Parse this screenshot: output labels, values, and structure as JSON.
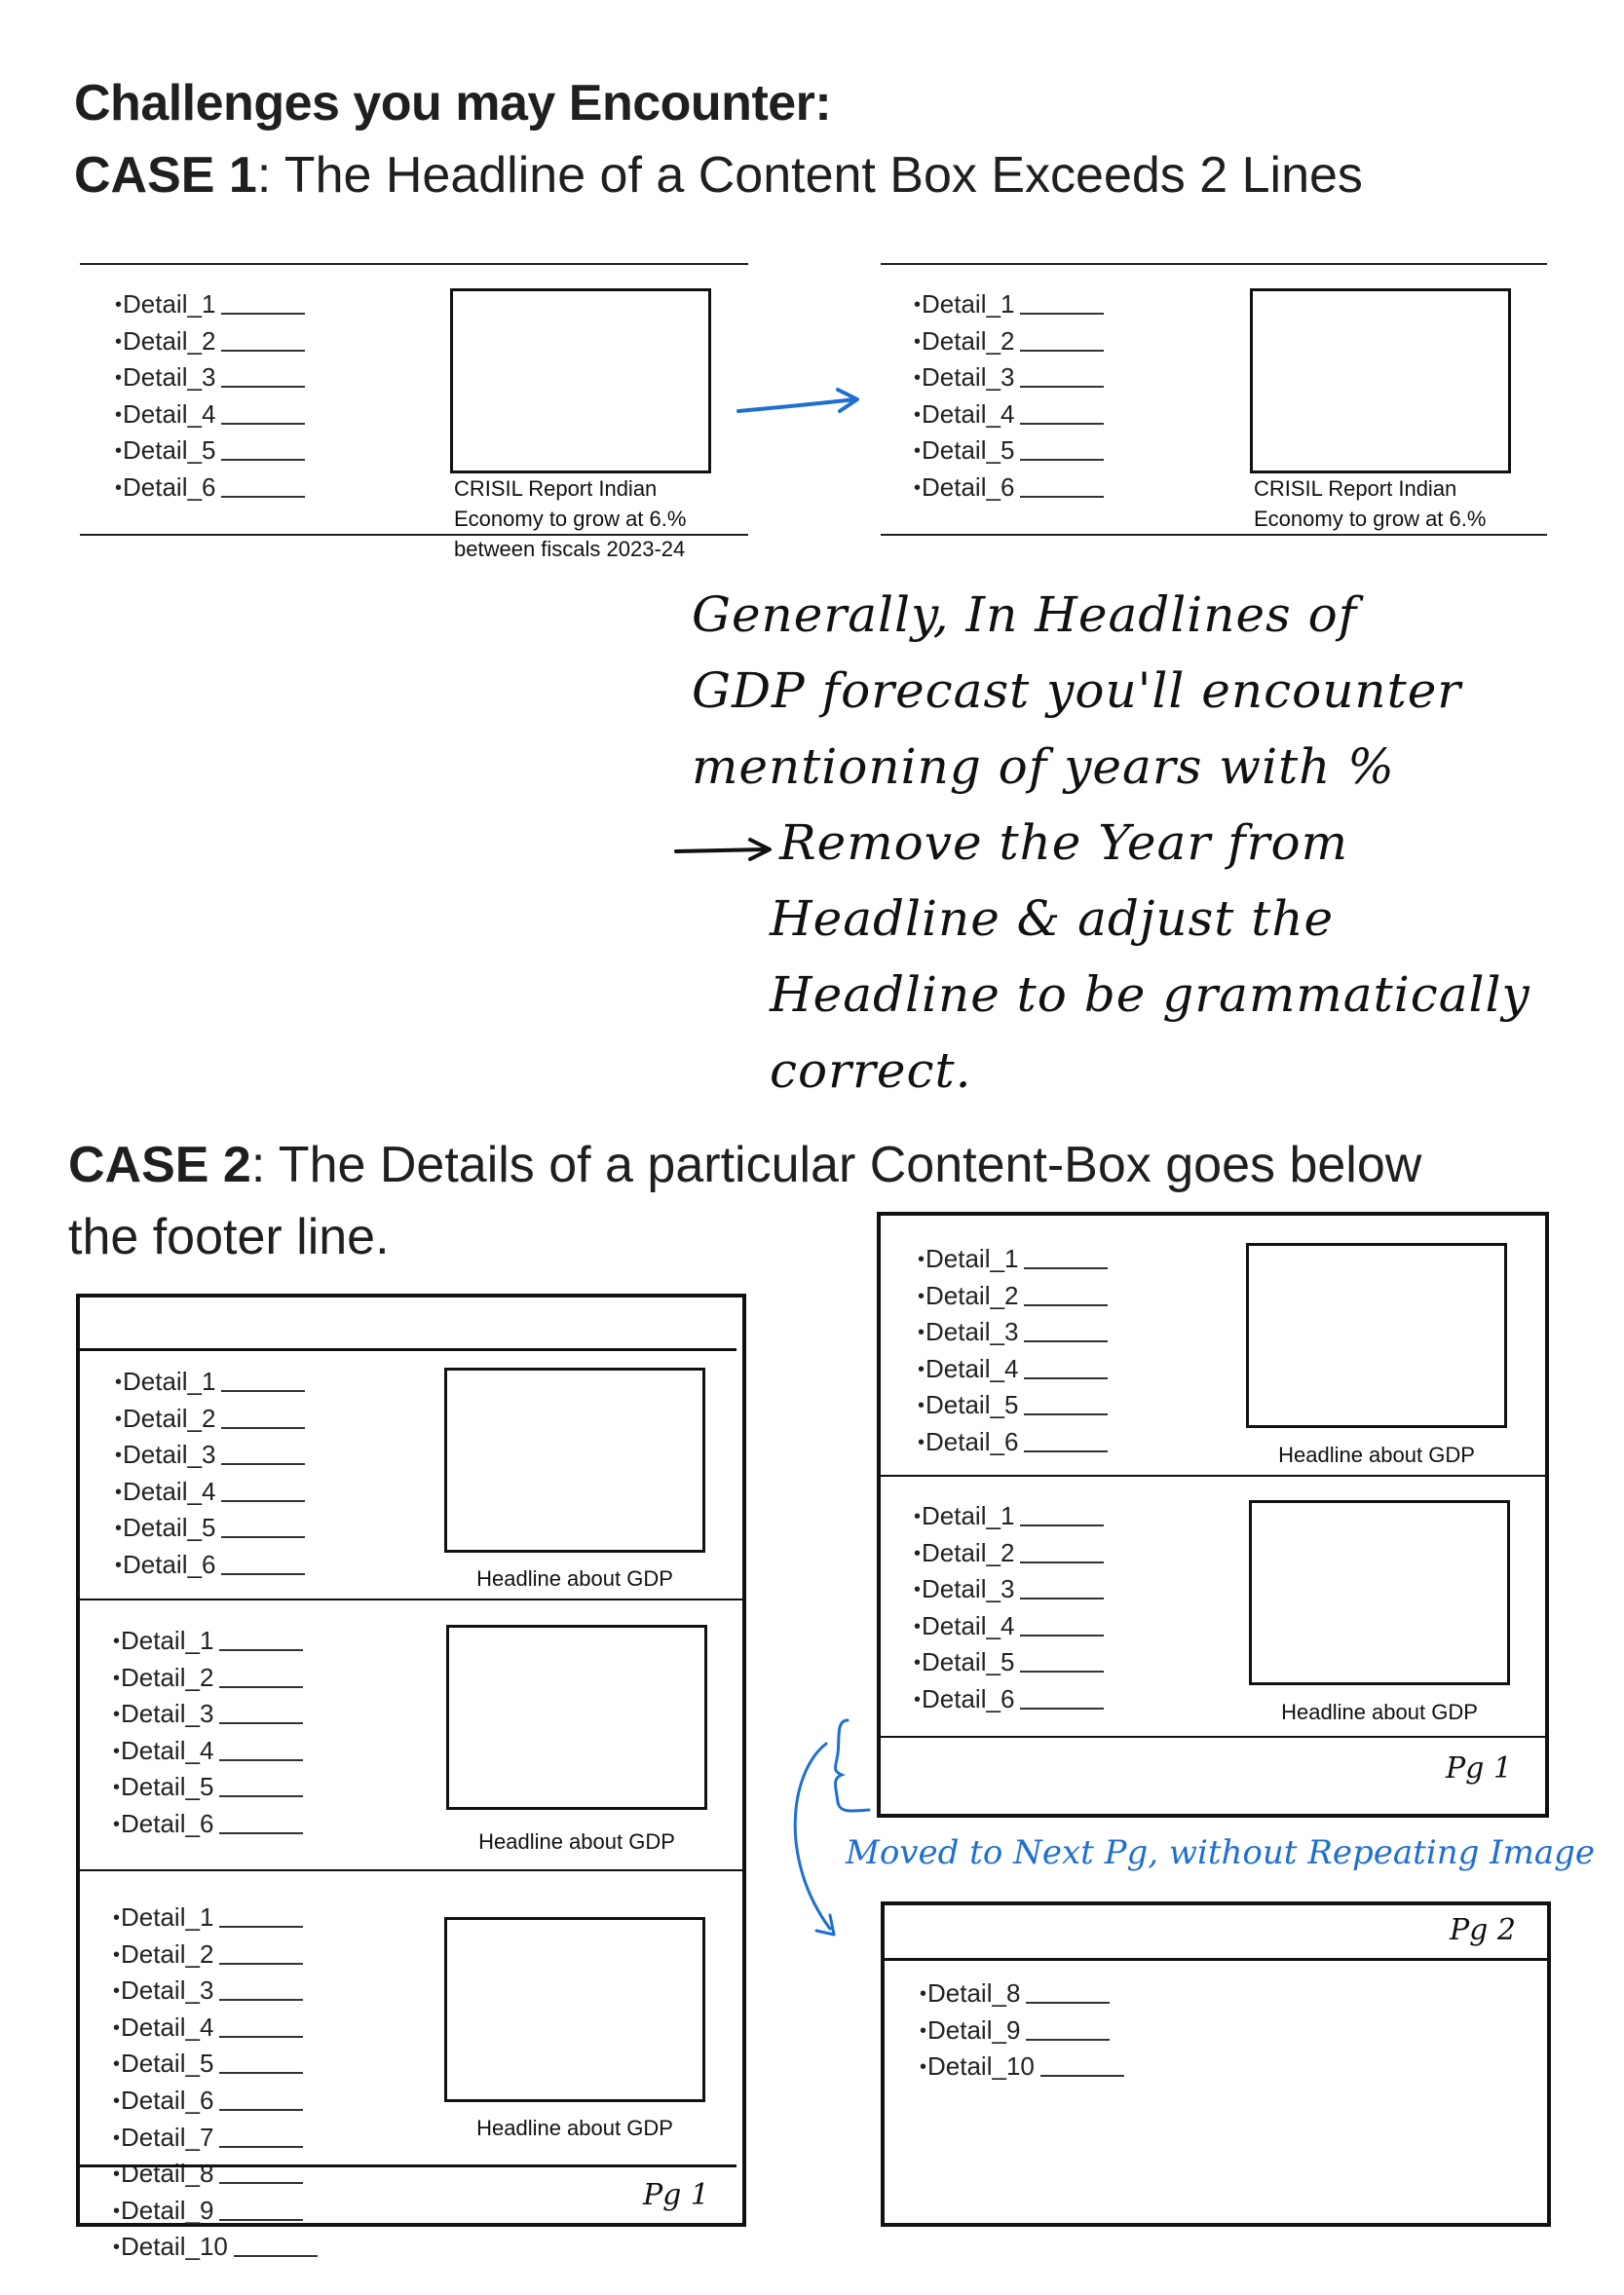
{
  "title": "Challenges you may Encounter:",
  "case1": {
    "label": "CASE 1",
    "text": ": The Headline of a Content Box Exceeds 2 Lines",
    "details": [
      "Detail_1",
      "Detail_2",
      "Detail_3",
      "Detail_4",
      "Detail_5",
      "Detail_6"
    ],
    "before_caption": [
      "CRISIL Report Indian",
      "Economy to grow at 6.%",
      "between fiscals 2023-24"
    ],
    "after_caption": [
      "CRISIL Report Indian",
      "Economy to grow at 6.%"
    ],
    "note_lines": [
      "Generally, In Headlines of",
      "GDP forecast you'll encounter",
      "mentioning of years with %",
      "Remove the Year from",
      "Headline & adjust the",
      "Headline to be grammatically",
      "correct."
    ],
    "arrow_color": "#1f6fd0"
  },
  "case2": {
    "label": "CASE 2",
    "text_line1": ": The Details of a particular Content-Box goes below",
    "text_line2": "the footer line.",
    "details6": [
      "Detail_1",
      "Detail_2",
      "Detail_3",
      "Detail_4",
      "Detail_5",
      "Detail_6"
    ],
    "details7": [
      "Detail_1",
      "Detail_2",
      "Detail_3",
      "Detail_4",
      "Detail_5",
      "Detail_6",
      "Detail_7"
    ],
    "overflow_details": [
      "Detail_8",
      "Detail_9",
      "Detail_10"
    ],
    "page2_details": [
      "Detail_8",
      "Detail_9",
      "Detail_10"
    ],
    "headline": "Headline about GDP",
    "pg1": "Pg 1",
    "pg2": "Pg 2",
    "blue_note": "Moved to Next Pg, without Repeating Image",
    "note_color": "#1f6fd0"
  }
}
